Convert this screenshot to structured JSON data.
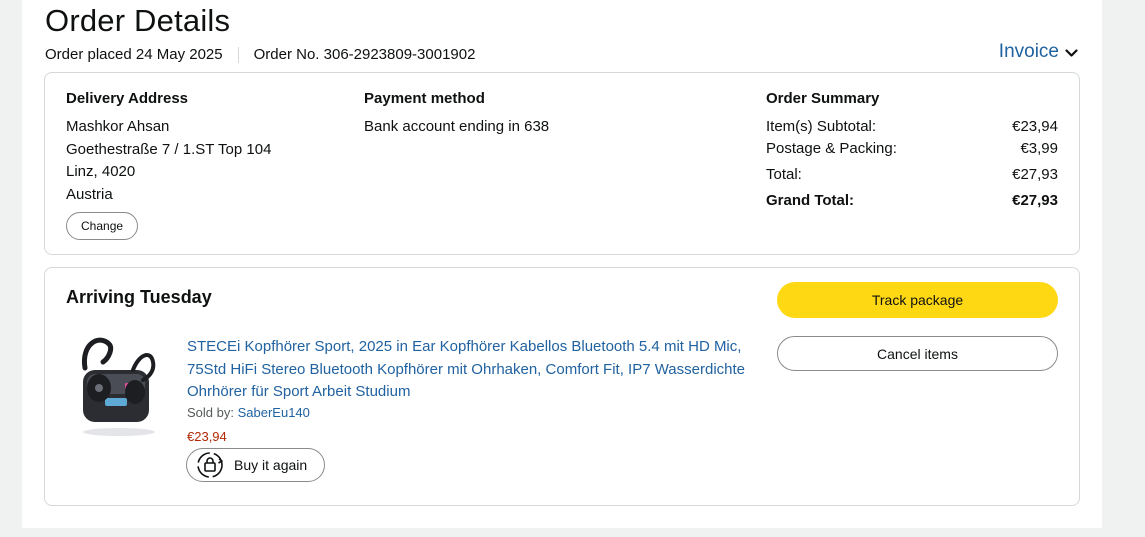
{
  "header": {
    "title": "Order Details",
    "order_placed": "Order placed 24 May 2025",
    "order_number": "Order No. 306-2923809-3001902",
    "invoice_label": "Invoice"
  },
  "delivery": {
    "heading": "Delivery Address",
    "lines": [
      "Mashkor Ahsan",
      "Goethestraße 7 / 1.ST Top 104",
      "Linz, 4020",
      "Austria"
    ],
    "change_label": "Change"
  },
  "payment": {
    "heading": "Payment method",
    "text": "Bank account ending in 638"
  },
  "summary": {
    "heading": "Order Summary",
    "rows": [
      {
        "label": "Item(s) Subtotal:",
        "value": "€23,94"
      },
      {
        "label": "Postage & Packing:",
        "value": "€3,99"
      },
      {
        "label": "Total:",
        "value": "€27,93"
      },
      {
        "label": "Grand Total:",
        "value": "€27,93"
      }
    ]
  },
  "shipment": {
    "arriving": "Arriving Tuesday",
    "product_title": "STECEi Kopfhörer Sport, 2025 in Ear Kopfhörer Kabellos Bluetooth 5.4 mit HD Mic, 75Std HiFi Stereo Bluetooth Kopfhörer mit Ohrhaken, Comfort Fit, IP7 Wasserdichte Ohrhörer für Sport Arbeit Studium",
    "sold_by_label": "Sold by:",
    "seller": "SaberEu140",
    "price": "€23,94",
    "buy_again_label": "Buy it again",
    "track_label": "Track package",
    "cancel_label": "Cancel items"
  },
  "colors": {
    "link": "#2162a1",
    "price": "#b12704",
    "primary_button": "#ffd814"
  }
}
